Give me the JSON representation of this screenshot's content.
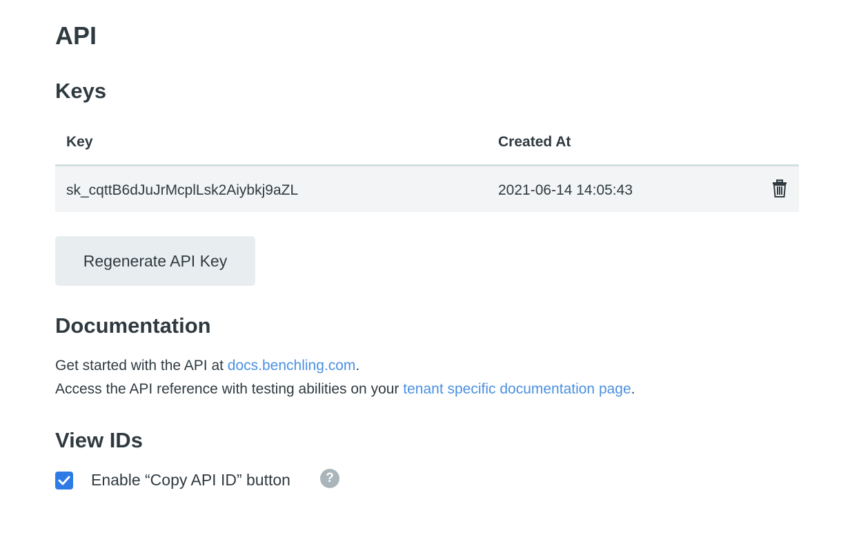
{
  "page": {
    "title": "API"
  },
  "keys": {
    "heading": "Keys",
    "columns": {
      "key": "Key",
      "created_at": "Created At"
    },
    "rows": [
      {
        "key": "sk_cqttB6dJuJrMcplLsk2Aiybkj9aZL",
        "created_at": "2021-06-14 14:05:43",
        "action_icon": "trash-icon"
      }
    ],
    "regenerate_label": "Regenerate API Key"
  },
  "documentation": {
    "heading": "Documentation",
    "line1_prefix": "Get started with the API at ",
    "line1_link": "docs.benchling.com",
    "line1_suffix": ".",
    "line2_prefix": "Access the API reference with testing abilities on your ",
    "line2_link": "tenant specific documentation page",
    "line2_suffix": "."
  },
  "view_ids": {
    "heading": "View IDs",
    "checkbox_label": "Enable “Copy API ID” button",
    "checkbox_checked": true,
    "help_glyph": "?"
  },
  "colors": {
    "text": "#2f3a40",
    "link": "#4a90e2",
    "checkbox": "#2f7be5",
    "row_bg": "#f2f4f5",
    "button_bg": "#e8eef0"
  }
}
